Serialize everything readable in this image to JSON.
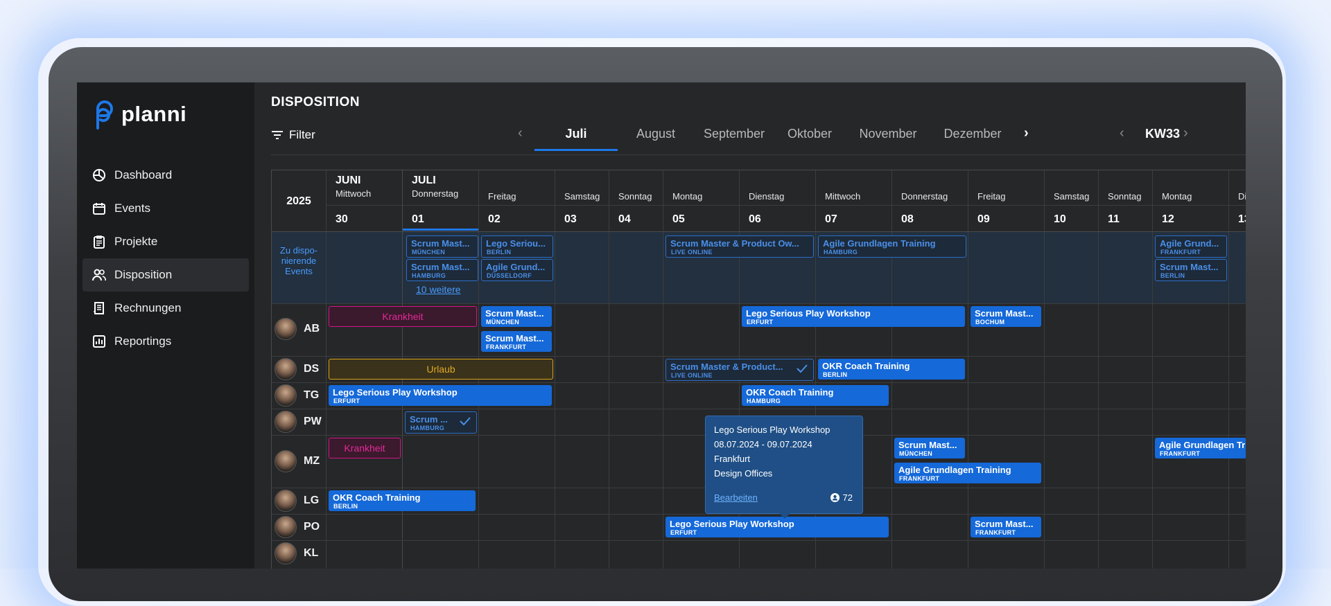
{
  "app": {
    "name": "planni"
  },
  "sidebar": {
    "items": [
      {
        "label": "Dashboard",
        "icon": "dashboard-icon"
      },
      {
        "label": "Events",
        "icon": "calendar-icon"
      },
      {
        "label": "Projekte",
        "icon": "clipboard-icon"
      },
      {
        "label": "Disposition",
        "icon": "users-icon",
        "active": true
      },
      {
        "label": "Rechnungen",
        "icon": "invoice-icon"
      },
      {
        "label": "Reportings",
        "icon": "chart-icon"
      }
    ]
  },
  "header": {
    "title": "DISPOSITION",
    "filter_label": "Filter",
    "months": [
      "Juli",
      "August",
      "September",
      "Oktober",
      "November",
      "Dezember"
    ],
    "active_month": "Juli",
    "week": "KW33"
  },
  "calendar": {
    "year": "2025",
    "month_labels": {
      "juni": "JUNI",
      "juli": "JULI"
    },
    "days": [
      {
        "name": "Mittwoch",
        "num": "30"
      },
      {
        "name": "Donnerstag",
        "num": "01"
      },
      {
        "name": "Freitag",
        "num": "02"
      },
      {
        "name": "Samstag",
        "num": "03"
      },
      {
        "name": "Sonntag",
        "num": "04"
      },
      {
        "name": "Montag",
        "num": "05"
      },
      {
        "name": "Dienstag",
        "num": "06"
      },
      {
        "name": "Mittwoch",
        "num": "07"
      },
      {
        "name": "Donnerstag",
        "num": "08"
      },
      {
        "name": "Freitag",
        "num": "09"
      },
      {
        "name": "Samstag",
        "num": "10"
      },
      {
        "name": "Sonntag",
        "num": "11"
      },
      {
        "name": "Montag",
        "num": "12"
      },
      {
        "name": "Di",
        "num": "13"
      }
    ],
    "unassigned_label": "Zu dispo-nierende Events",
    "more_link": "10 weitere"
  },
  "people": [
    {
      "initials": "AB"
    },
    {
      "initials": "DS"
    },
    {
      "initials": "TG"
    },
    {
      "initials": "PW"
    },
    {
      "initials": "MZ"
    },
    {
      "initials": "LG"
    },
    {
      "initials": "PO"
    },
    {
      "initials": "KL"
    }
  ],
  "status_labels": {
    "sick": "Krankheit",
    "vacation": "Urlaub"
  },
  "events": [
    {
      "title": "Scrum Mast...",
      "loc": "München"
    },
    {
      "title": "Scrum Mast...",
      "loc": "Hamburg"
    },
    {
      "title": "Lego Seriou...",
      "loc": "Berlin"
    },
    {
      "title": "Agile Grund...",
      "loc": "Düsseldorf"
    },
    {
      "title": "Scrum Master & Product Ow...",
      "loc": "Live Online"
    },
    {
      "title": "Agile Grundlagen Training",
      "loc": "Hamburg"
    },
    {
      "title": "Agile Grund...",
      "loc": "Frankfurt"
    },
    {
      "title": "Scrum Mast...",
      "loc": "Berlin"
    },
    {
      "title": "Scrum Mast...",
      "loc": "München"
    },
    {
      "title": "Scrum Mast...",
      "loc": "Frankfurt"
    },
    {
      "title": "Lego Serious Play Workshop",
      "loc": "Erfurt"
    },
    {
      "title": "Scrum Mast...",
      "loc": "Bochum"
    },
    {
      "title": "Scrum Master & Product...",
      "loc": "Live Online"
    },
    {
      "title": "OKR Coach Training",
      "loc": "Berlin"
    },
    {
      "title": "Lego Serious Play Workshop",
      "loc": "Erfurt"
    },
    {
      "title": "OKR Coach Training",
      "loc": "Hamburg"
    },
    {
      "title": "Scrum ...",
      "loc": "Hamburg"
    },
    {
      "title": "Scrum Mast...",
      "loc": "München"
    },
    {
      "title": "Agile Grundlagen Training",
      "loc": "Frankfurt"
    },
    {
      "title": "Agile Grundlagen Tr",
      "loc": "Frankfurt"
    },
    {
      "title": "OKR Coach Training",
      "loc": "Berlin"
    },
    {
      "title": "Lego Serious Play Workshop",
      "loc": "Erfurt"
    },
    {
      "title": "Scrum Mast...",
      "loc": "Frankfurt"
    }
  ],
  "tooltip": {
    "title": "Lego Serious Play Workshop",
    "dates": "08.07.2024 - 09.07.2024",
    "city": "Frankfurt",
    "venue": "Design Offices",
    "edit_label": "Bearbeiten",
    "count": "72"
  },
  "colors": {
    "accent": "#1e78e8",
    "event": "#1569d9",
    "sick": "#d4148a",
    "vacation": "#d9a21a"
  }
}
